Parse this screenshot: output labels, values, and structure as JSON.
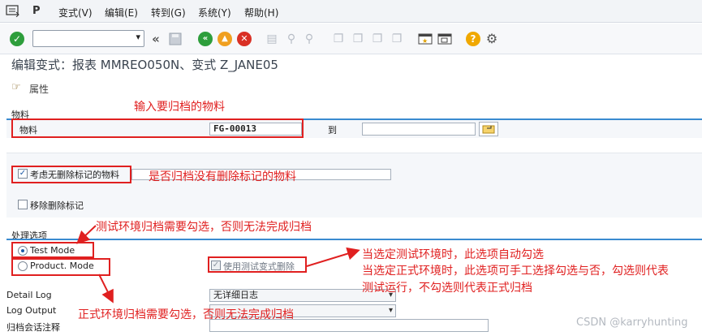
{
  "menu": {
    "items": [
      "变式(V)",
      "编辑(E)",
      "转到(G)",
      "系统(Y)",
      "帮助(H)"
    ]
  },
  "toolbar": {
    "command_value": ""
  },
  "page": {
    "title": "编辑变式：报表 MMREO050N、变式 Z_JANE05",
    "attributes": "属性"
  },
  "material_section": {
    "header": "物料",
    "field_label": "物料",
    "from_value": "FG-00013",
    "to_label": "到",
    "to_value": ""
  },
  "options": {
    "consider_deletion_flag": {
      "label": "考虑无删除标记的物料",
      "checked": true
    },
    "remove_deletion_flag": {
      "label": "移除删除标记",
      "checked": false
    }
  },
  "processing": {
    "header": "处理选项",
    "test_mode": "Test Mode",
    "product_mode": "Product. Mode",
    "selected": "test",
    "use_test_variant_delete": {
      "label": "使用测试变式删除",
      "checked": true
    }
  },
  "bottom_fields": {
    "detail_log_label": "Detail Log",
    "detail_log_value": "无详细日志",
    "log_output_label": "Log Output",
    "log_output_value": "",
    "archive_note_label": "归档会话注释",
    "archive_note_value": ""
  },
  "annotations": {
    "a1": "输入要归档的物料",
    "a2": "是否归档没有删除标记的物料",
    "a3": "测试环境归档需要勾选，否则无法完成归档",
    "a4": "当选定测试环境时，此选项自动勾选",
    "a5": "当选定正式环境时，此选项可手工选择勾选与否，勾选则代表",
    "a6": "测试运行，不勾选则代表正式归档",
    "a7": "正式环境归档需要勾选，否则无法完成归档"
  },
  "watermark": "CSDN @karryhunting",
  "colors": {
    "annotation_red": "#e02020",
    "section_blue": "#3a8bd0"
  }
}
